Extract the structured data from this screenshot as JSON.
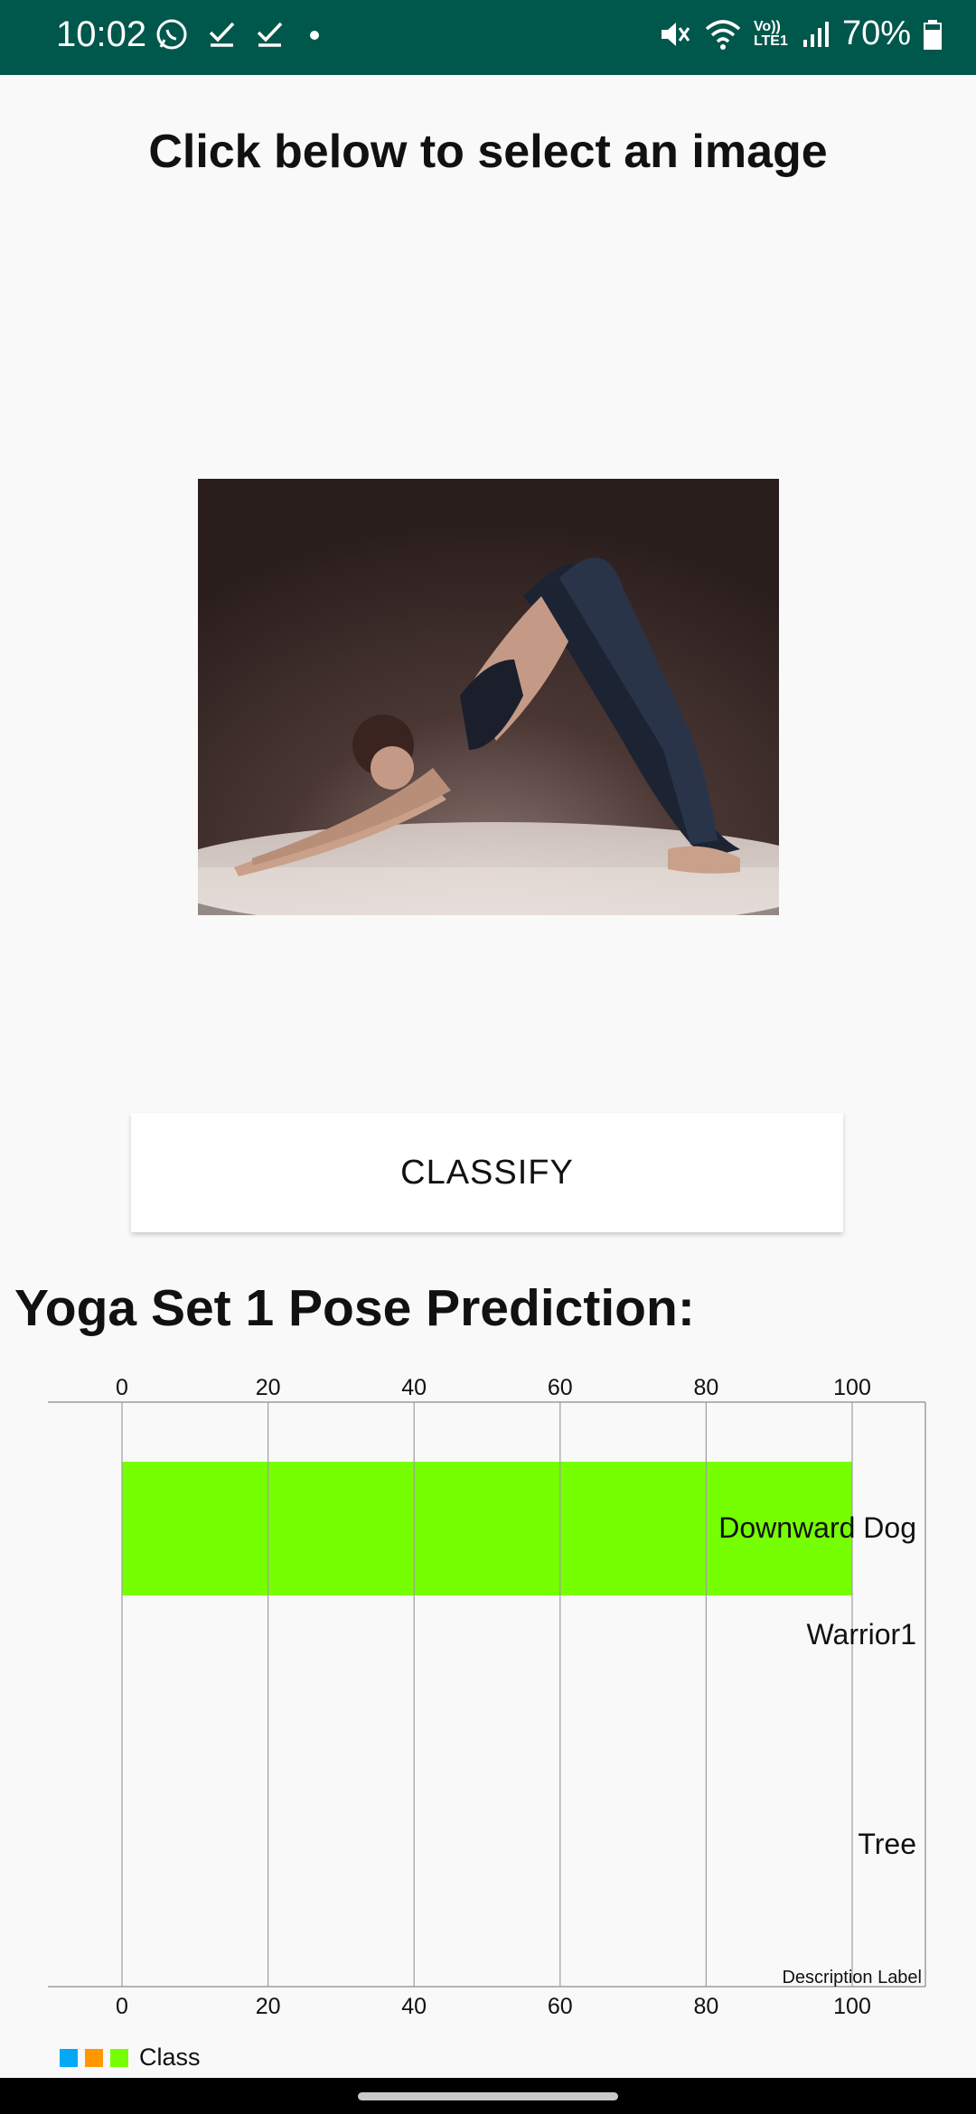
{
  "status_bar": {
    "time": "10:02",
    "battery": "70%",
    "network_label": "Vo)) LTE1",
    "icons": [
      "whatsapp-icon",
      "check-icon",
      "check-icon",
      "dot-icon",
      "mute-icon",
      "wifi-icon",
      "signal-icon",
      "battery-icon"
    ]
  },
  "title": "Click below to select an image",
  "image": {
    "description_icon": "yoga-photo"
  },
  "classify_button": "CLASSIFY",
  "prediction_heading": "Yoga Set 1 Pose Prediction:",
  "chart_data": {
    "type": "bar",
    "orientation": "horizontal",
    "categories": [
      "Downward Dog",
      "Warrior1",
      "Tree"
    ],
    "series": [
      {
        "name": "Class",
        "values": [
          100,
          0,
          0
        ],
        "colors": [
          "#76ff03",
          "#ff9800",
          "#03a9f4"
        ]
      }
    ],
    "xlim": [
      0,
      100
    ],
    "x_ticks": [
      0,
      20,
      40,
      60,
      80,
      100
    ],
    "description_label": "Description Label",
    "grid": true,
    "legend": "bottom-left"
  }
}
